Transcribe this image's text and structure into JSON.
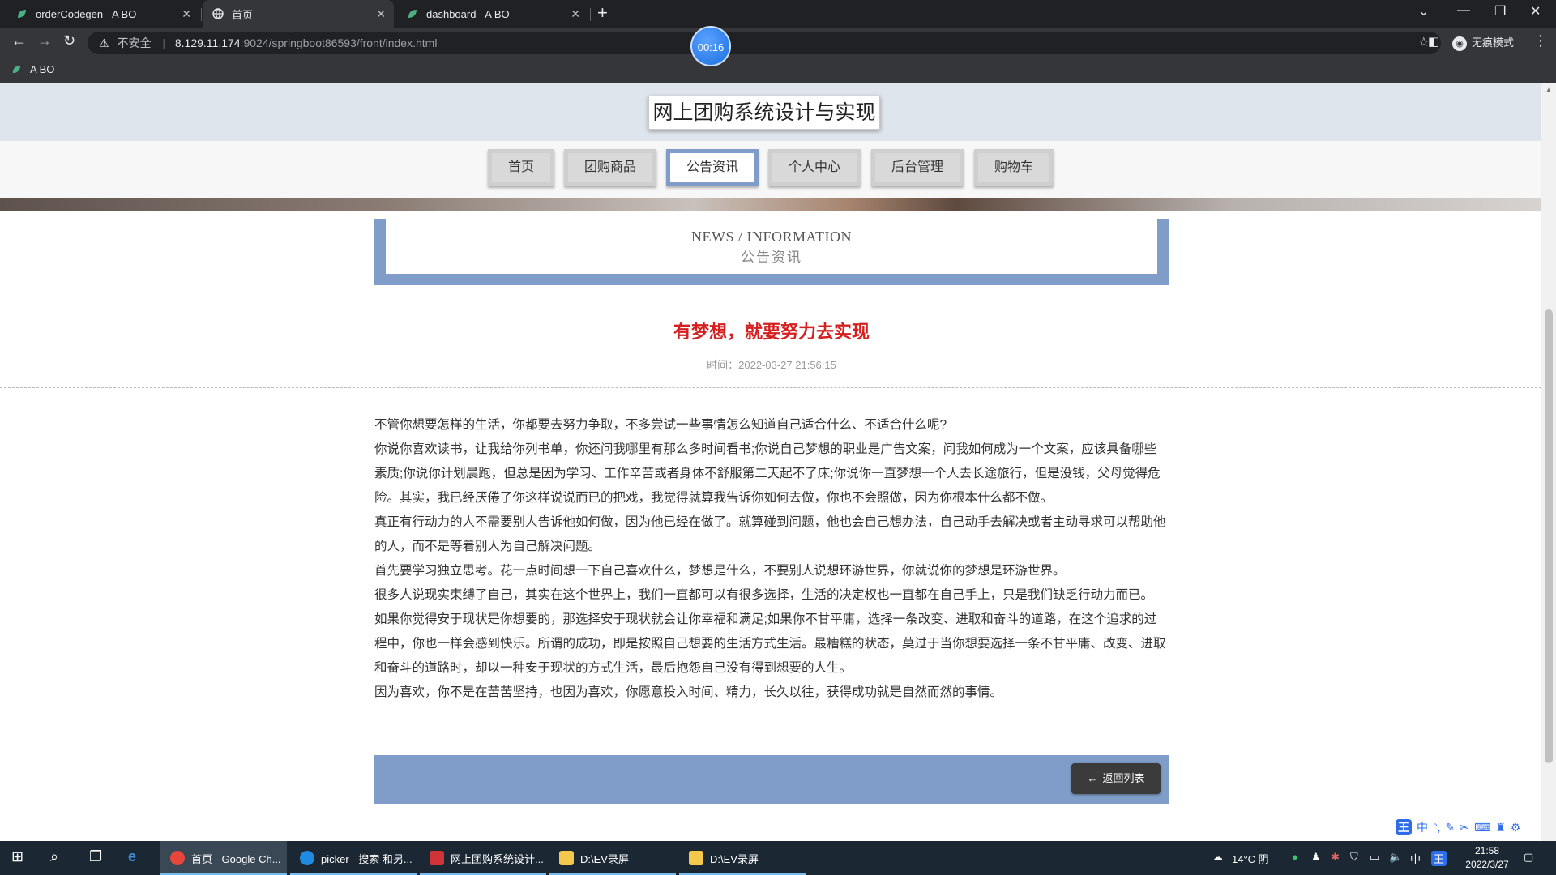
{
  "browser": {
    "tabs": [
      {
        "title": "orderCodegen - A BO",
        "active": false
      },
      {
        "title": "首页",
        "active": true
      },
      {
        "title": "dashboard - A BO",
        "active": false
      }
    ],
    "address": {
      "insecure_label": "不安全",
      "host": "8.129.11.174",
      "path": ":9024/springboot86593/front/index.html"
    },
    "timer": "00:16",
    "profile_label": "无痕模式",
    "bookmark": "A BO"
  },
  "site": {
    "title": "网上团购系统设计与实现",
    "nav": [
      {
        "label": "首页",
        "active": false
      },
      {
        "label": "团购商品",
        "active": false
      },
      {
        "label": "公告资讯",
        "active": true
      },
      {
        "label": "个人中心",
        "active": false
      },
      {
        "label": "后台管理",
        "active": false
      },
      {
        "label": "购物车",
        "active": false
      }
    ]
  },
  "news_header": {
    "en": "NEWS / INFORMATION",
    "cn": "公告资讯"
  },
  "article": {
    "title": "有梦想，就要努力去实现",
    "time_label": "时间：",
    "time": "2022-03-27 21:56:15",
    "paragraphs": [
      "不管你想要怎样的生活，你都要去努力争取，不多尝试一些事情怎么知道自己适合什么、不适合什么呢?",
      "你说你喜欢读书，让我给你列书单，你还问我哪里有那么多时间看书;你说自己梦想的职业是广告文案，问我如何成为一个文案，应该具备哪些素质;你说你计划晨跑，但总是因为学习、工作辛苦或者身体不舒服第二天起不了床;你说你一直梦想一个人去长途旅行，但是没钱，父母觉得危险。其实，我已经厌倦了你这样说说而已的把戏，我觉得就算我告诉你如何去做，你也不会照做，因为你根本什么都不做。",
      "真正有行动力的人不需要别人告诉他如何做，因为他已经在做了。就算碰到问题，他也会自己想办法，自己动手去解决或者主动寻求可以帮助他的人，而不是等着别人为自己解决问题。",
      "首先要学习独立思考。花一点时间想一下自己喜欢什么，梦想是什么，不要别人说想环游世界，你就说你的梦想是环游世界。",
      "很多人说现实束缚了自己，其实在这个世界上，我们一直都可以有很多选择，生活的决定权也一直都在自己手上，只是我们缺乏行动力而已。",
      "如果你觉得安于现状是你想要的，那选择安于现状就会让你幸福和满足;如果你不甘平庸，选择一条改变、进取和奋斗的道路，在这个追求的过程中，你也一样会感到快乐。所谓的成功，即是按照自己想要的生活方式生活。最糟糕的状态，莫过于当你想要选择一条不甘平庸、改变、进取和奋斗的道路时，却以一种安于现状的方式生活，最后抱怨自己没有得到想要的人生。",
      "因为喜欢，你不是在苦苦坚持，也因为喜欢，你愿意投入时间、精力，长久以往，获得成功就是自然而然的事情。"
    ]
  },
  "footer": {
    "hint": "",
    "back_label": "返回列表"
  },
  "taskbar": {
    "apps": [
      {
        "label": "首页 - Google Ch...",
        "active": true,
        "color": "#e8453c"
      },
      {
        "label": "picker - 搜索 和另...",
        "active": false,
        "color": "#1f8ae0"
      },
      {
        "label": "网上团购系统设计...",
        "active": false,
        "color": "#d13438"
      },
      {
        "label": "D:\\EV录屏",
        "active": false,
        "color": "#f2c94c"
      },
      {
        "label": "D:\\EV录屏",
        "active": false,
        "color": "#f2c94c"
      }
    ],
    "weather": "14°C 阴",
    "ime_lang": "中",
    "time": "21:58",
    "date": "2022/3/27"
  },
  "colors": {
    "accent": "#7f9dc8",
    "title_red": "#d42020"
  }
}
